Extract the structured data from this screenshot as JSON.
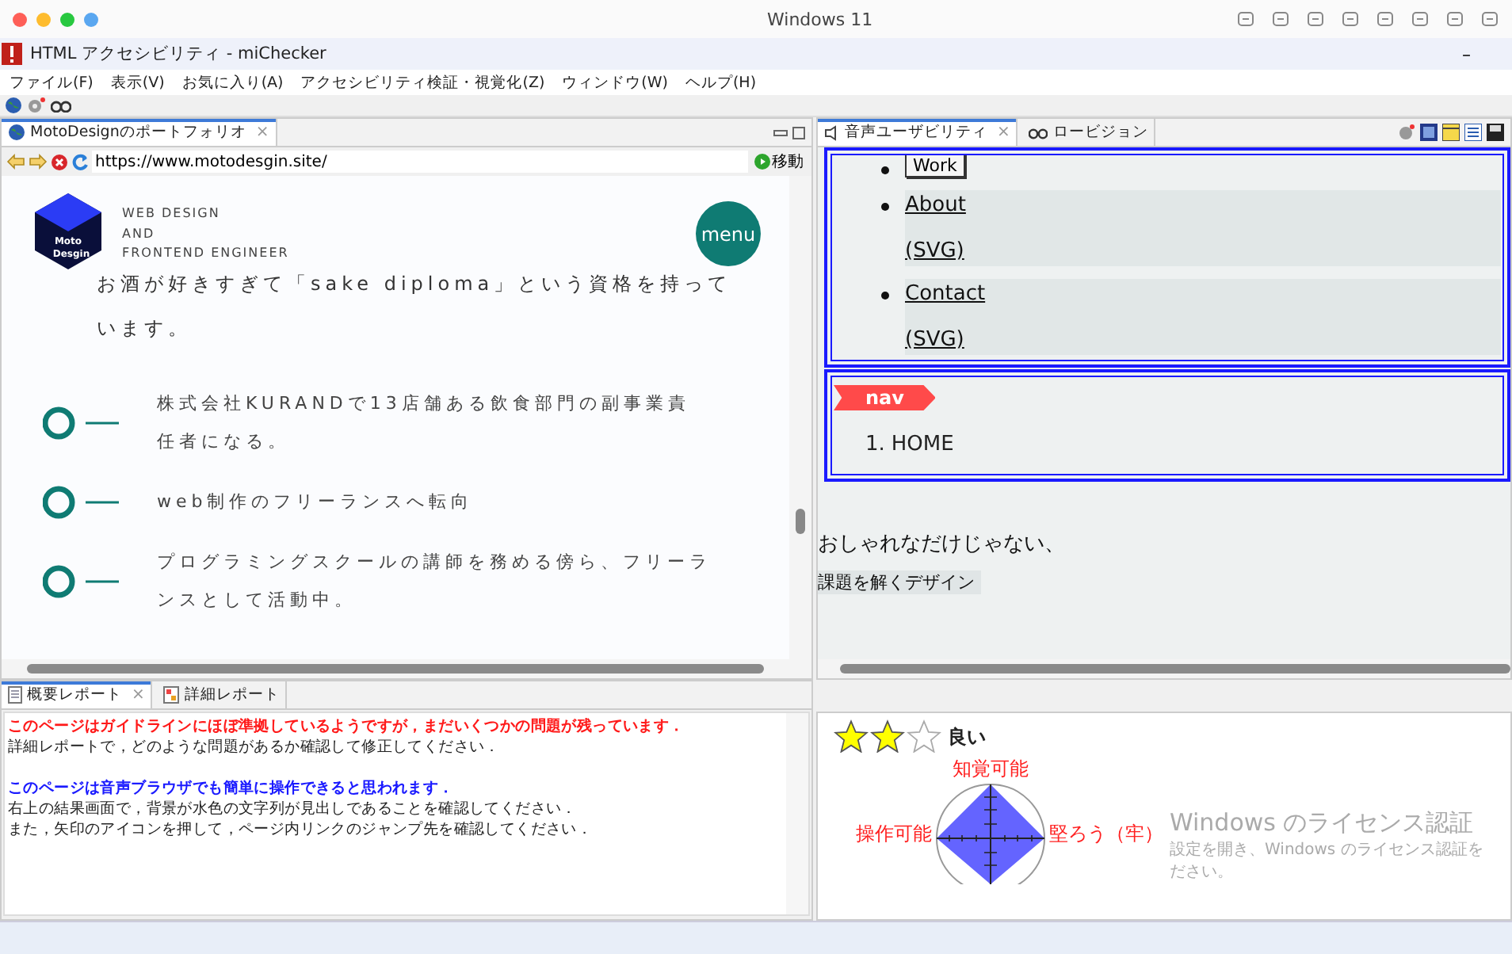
{
  "mac_bar": {
    "title": "Windows 11"
  },
  "window": {
    "title": "HTML アクセシビリティ - miChecker",
    "minimize": "–"
  },
  "menu": [
    "ファイル(F)",
    "表示(V)",
    "お気に入り(A)",
    "アクセシビリティ検証・視覚化(Z)",
    "ウィンドウ(W)",
    "ヘルプ(H)"
  ],
  "browser": {
    "tab": {
      "label": "MotoDesignのポートフォリオ",
      "close": "×"
    },
    "url": "https://www.motodesgin.site/",
    "go": "移動",
    "page": {
      "logo": [
        "Moto",
        "Desgin"
      ],
      "tagline": [
        "WEB DESIGN",
        "AND",
        "FRONTEND ENGINEER"
      ],
      "menu": "menu",
      "intro": "お酒が好きすぎて「sake diploma」という資格を持っています。",
      "timeline": [
        "株式会社KURANDで13店舗ある飲食部門の副事業責任者になる。",
        "web制作のフリーランスへ転向",
        "プログラミングスクールの講師を務める傍ら、フリーランスとして活動中。"
      ]
    }
  },
  "voice": {
    "tabs": [
      {
        "label": "音声ユーザビリティ",
        "close": "×",
        "selected": true
      },
      {
        "label": "ロービジョン",
        "selected": false
      }
    ],
    "links": [
      {
        "kind": "button",
        "label": "Work"
      },
      {
        "kind": "link",
        "label": "About",
        "note": "(SVG)"
      },
      {
        "kind": "link",
        "label": "Contact",
        "note": "(SVG)"
      }
    ],
    "nav_tag": "nav",
    "ordered": [
      {
        "number": "1.",
        "label": "HOME"
      }
    ],
    "text": [
      "おしゃれなだけじゃない、",
      "課題を解くデザイン"
    ]
  },
  "report": {
    "tabs": [
      {
        "label": "概要レポート",
        "close": "×",
        "selected": true
      },
      {
        "label": "詳細レポート",
        "selected": false
      }
    ],
    "lines": [
      {
        "kind": "warning",
        "text": "このページはガイドラインにほぼ準拠しているようですが，まだいくつかの問題が残っています．"
      },
      {
        "kind": "text",
        "text": "詳細レポートで，どのような問題があるか確認して修正してください．"
      },
      {
        "kind": "info",
        "text": "このページは音声ブラウザでも簡単に操作できると思われます．"
      },
      {
        "kind": "text",
        "text": " 右上の結果画面で，背景が水色の文字列が見出しであることを確認してください．"
      },
      {
        "kind": "text",
        "text": " また，矢印のアイコンを押して，ページ内リンクのジャンプ先を確認してください．"
      }
    ]
  },
  "score": {
    "stars": 2,
    "rating": "良い",
    "axes": [
      "知覚可能",
      "操作可能",
      "堅ろう（牢）"
    ]
  },
  "activation": {
    "title": "Windows のライセンス認証",
    "body": [
      "設定を開き、Windows のライセンス認証を",
      "ださい。"
    ]
  }
}
